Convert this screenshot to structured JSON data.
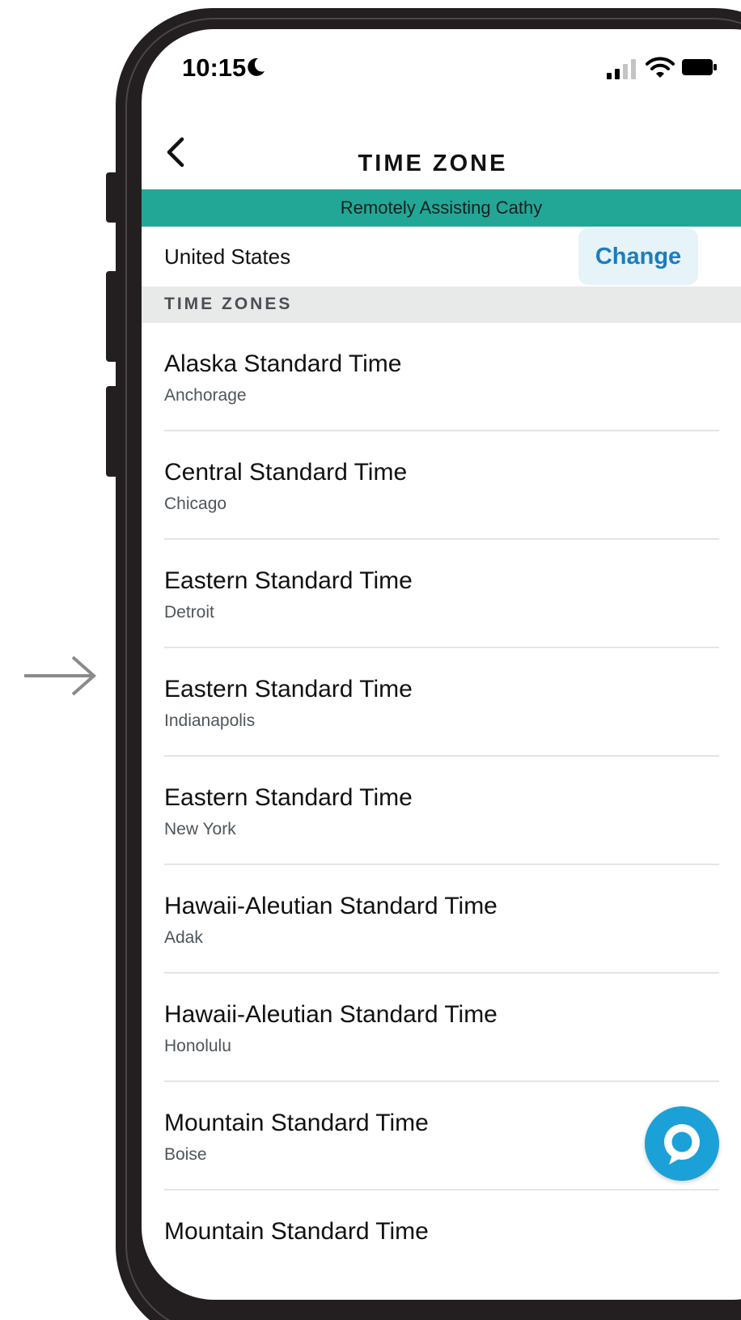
{
  "status_bar": {
    "time": "10:15",
    "icons": [
      "moon-icon",
      "signal-icon",
      "wifi-icon",
      "battery-icon"
    ]
  },
  "header": {
    "title": "TIME ZONE",
    "back_icon": "chevron-left-icon"
  },
  "banner": {
    "text": "Remotely Assisting Cathy",
    "color": "#22a797"
  },
  "country": {
    "value": "United States",
    "change_label": "Change",
    "accent": "#1b7dbd"
  },
  "section": {
    "title": "TIME ZONES"
  },
  "timezones": [
    {
      "name": "Alaska Standard Time",
      "city": "Anchorage"
    },
    {
      "name": "Central Standard Time",
      "city": "Chicago"
    },
    {
      "name": "Eastern Standard Time",
      "city": "Detroit"
    },
    {
      "name": "Eastern Standard Time",
      "city": "Indianapolis"
    },
    {
      "name": "Eastern Standard Time",
      "city": "New York"
    },
    {
      "name": "Hawaii-Aleutian Standard Time",
      "city": "Adak"
    },
    {
      "name": "Hawaii-Aleutian Standard Time",
      "city": "Honolulu"
    },
    {
      "name": "Mountain Standard Time",
      "city": "Boise"
    },
    {
      "name": "Mountain Standard Time",
      "city": ""
    }
  ],
  "alexa_button": {
    "icon": "alexa-icon",
    "color": "#1ca0d8"
  }
}
